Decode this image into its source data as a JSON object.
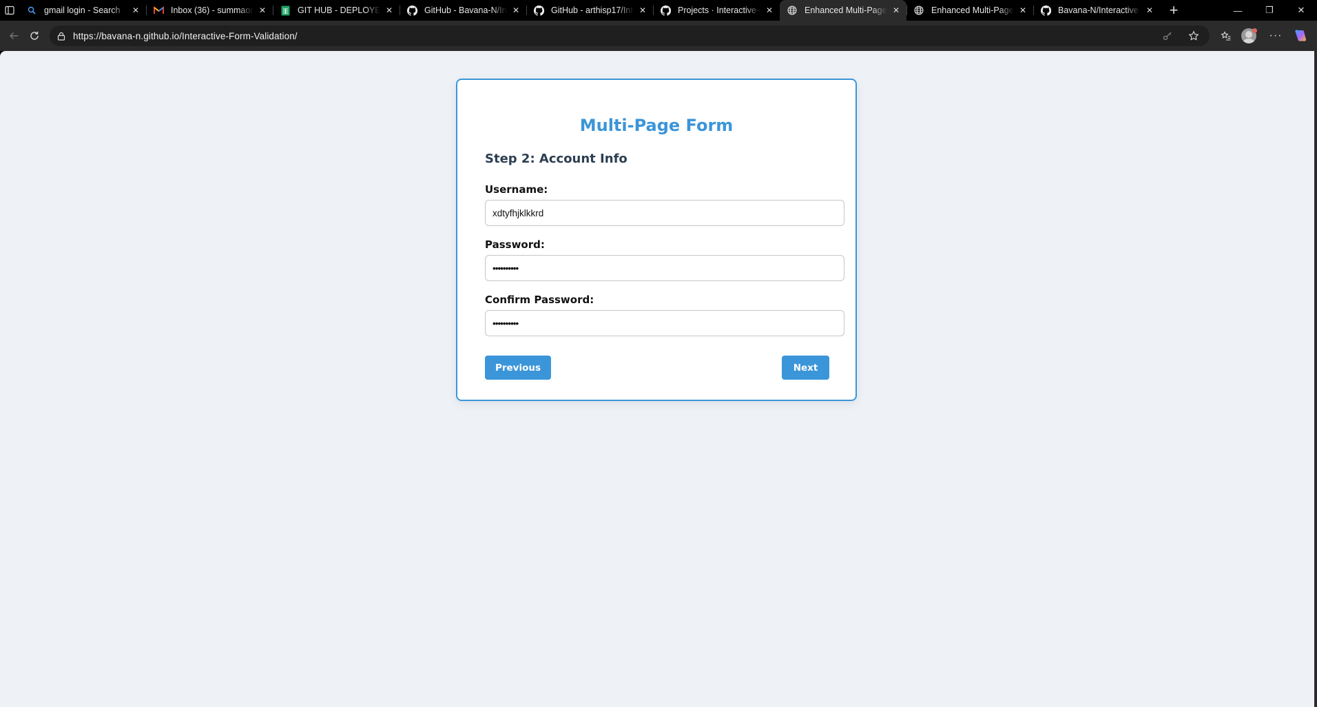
{
  "browser": {
    "tabs": [
      {
        "title": "gmail login - Search",
        "icon": "search-icon",
        "active": false
      },
      {
        "title": "Inbox (36) - summaoru",
        "icon": "gmail-icon",
        "active": false
      },
      {
        "title": "GIT HUB - DEPLOYED L",
        "icon": "sheets-icon",
        "active": false
      },
      {
        "title": "GitHub - Bavana-N/Inte",
        "icon": "github-icon",
        "active": false
      },
      {
        "title": "GitHub - arthisp17/Inte",
        "icon": "github-icon",
        "active": false
      },
      {
        "title": "Projects · Interactive-Fo",
        "icon": "github-icon",
        "active": false
      },
      {
        "title": "Enhanced Multi-Page F",
        "icon": "globe-icon",
        "active": true
      },
      {
        "title": "Enhanced Multi-Page F",
        "icon": "globe-icon",
        "active": false
      },
      {
        "title": "Bavana-N/Interactive-F",
        "icon": "github-icon",
        "active": false
      }
    ],
    "new_tab_symbol": "+",
    "url": "https://bavana-n.github.io/Interactive-Form-Validation/",
    "window_controls": {
      "minimize": "—",
      "restore": "❐",
      "close": "✕"
    }
  },
  "form": {
    "title": "Multi-Page Form",
    "step_heading": "Step 2: Account Info",
    "fields": {
      "username": {
        "label": "Username:",
        "value": "xdtyfhjklkkrd"
      },
      "password": {
        "label": "Password:",
        "value": "••••••••••"
      },
      "confirm_password": {
        "label": "Confirm Password:",
        "value": "••••••••••"
      }
    },
    "buttons": {
      "previous": "Previous",
      "next": "Next"
    }
  },
  "colors": {
    "accent": "#3b95d9",
    "page_background": "#eef2f7",
    "heading_text": "#2c3e50"
  }
}
